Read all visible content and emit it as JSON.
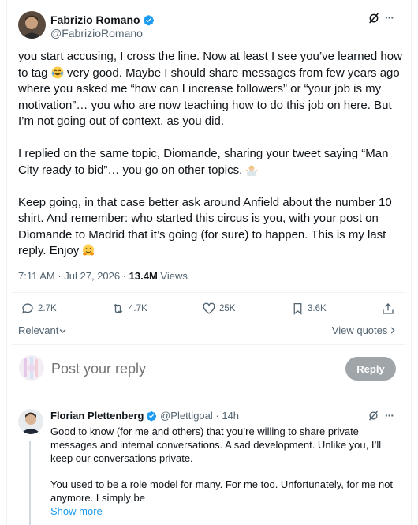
{
  "tweet": {
    "author_name": "Fabrizio Romano",
    "author_handle": "@FabrizioRomano",
    "text_parts": [
      "you start accusing, I cross the line. Now at least I see you’ve learned how to tag ",
      " very good. Maybe I should share messages from few years ago where you asked me “how can I increase followers” or “your job is my motivation”… you who are now teaching how to do this job on here. But I’m not going out of context, as you did.\n\nI replied on the same topic, Diomande, sharing your tweet saying “Man City ready to bid”… you go on other topics. ",
      "\n\nKeep going, in that case better ask around Anfield about the number 10 shirt. And remember: who started this circus is you, with your post on Diomande to Madrid that it’s going (for sure) to happen. This is my last reply. Enjoy "
    ],
    "timestamp": "7:11 AM · Jul 27, 2026 · ",
    "views_count": "13.4M",
    "views_label": " Views",
    "stats": {
      "replies": "2.7K",
      "reposts": "4.7K",
      "likes": "25K",
      "bookmarks": "3.6K"
    }
  },
  "controls": {
    "sort_label": "Relevant",
    "view_quotes_label": "View quotes",
    "reply_placeholder": "Post your reply",
    "reply_button": "Reply",
    "more_label": "···"
  },
  "reply": {
    "author_name": "Florian Plettenberg",
    "author_handle": "@Plettigoal",
    "time": " · 14h",
    "text": "Good to know (for me and others) that you’re willing to share private messages and internal conversations. A sad development. Unlike you, I’ll keep our conversations private.\n\nYou used to be a role model for many. For me too. Unfortunately, for me not anymore. I simply be",
    "show_more": "Show more"
  },
  "colors": {
    "accent": "#1d9bf0",
    "muted": "#536471",
    "verified": "#1d9bf0",
    "reply_button_disabled": "#a0a5aa"
  },
  "icons": [
    "verified-badge-icon",
    "grok-icon",
    "more-icon",
    "reply-icon",
    "repost-icon",
    "like-icon",
    "bookmark-icon",
    "share-icon",
    "chevron-down-icon",
    "chevron-right-icon",
    "emoji-laughing",
    "emoji-person-shrugging",
    "emoji-hugging"
  ]
}
